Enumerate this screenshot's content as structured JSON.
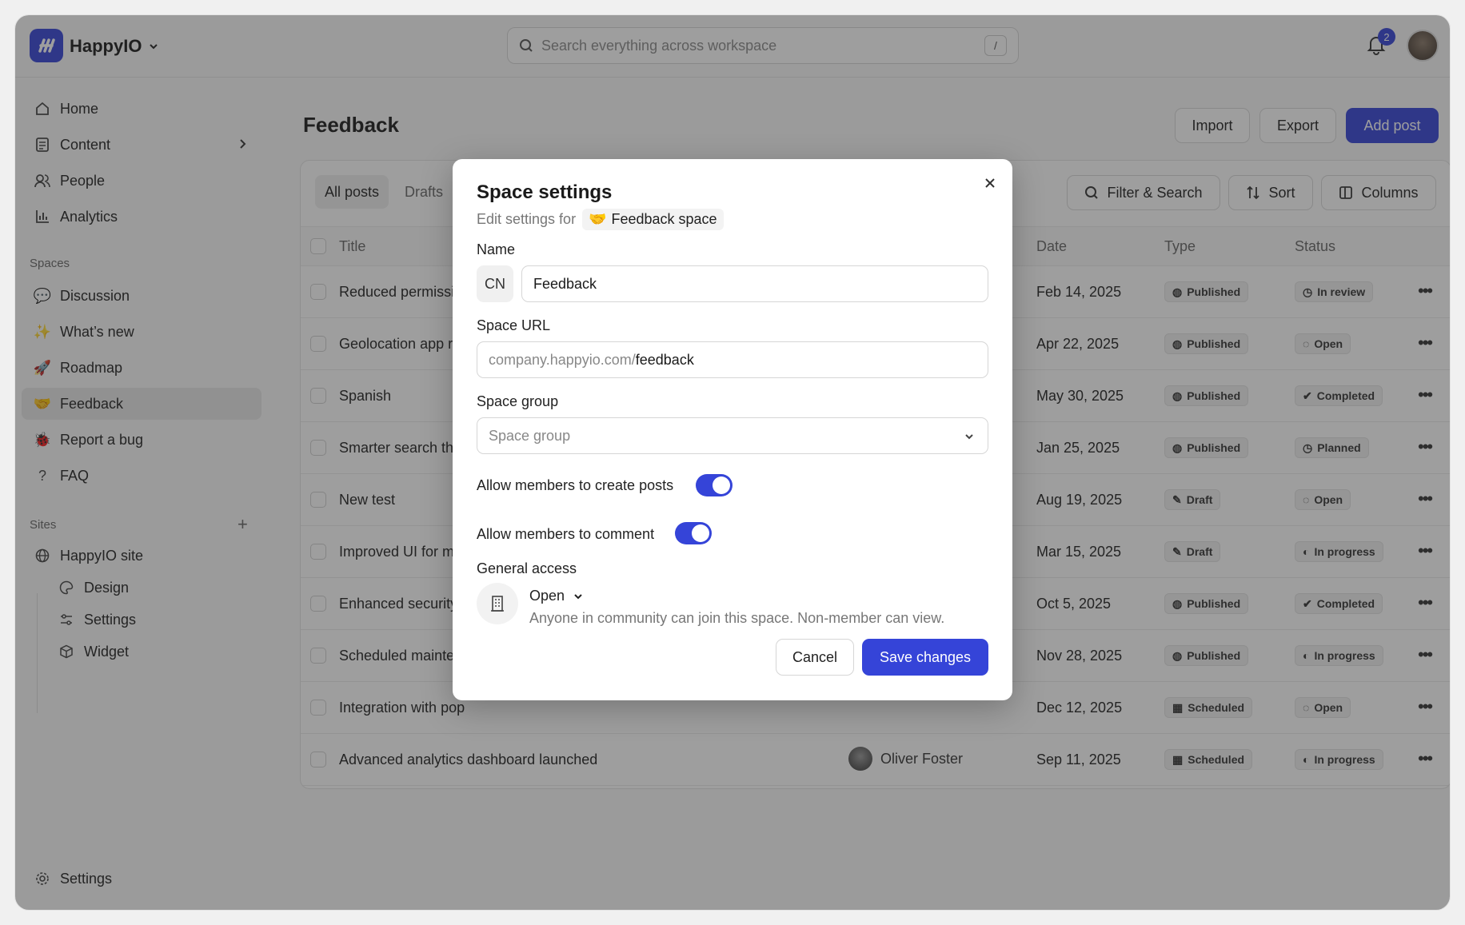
{
  "app": {
    "name": "HappyIO",
    "notifications": "2"
  },
  "search": {
    "placeholder": "Search everything across workspace",
    "shortcut": "/"
  },
  "sidebar": {
    "main": [
      {
        "label": "Home",
        "icon": "home-icon"
      },
      {
        "label": "Content",
        "icon": "document-icon"
      },
      {
        "label": "People",
        "icon": "people-icon"
      },
      {
        "label": "Analytics",
        "icon": "chart-icon"
      }
    ],
    "spaces_label": "Spaces",
    "spaces": [
      {
        "label": "Discussion",
        "icon": "speech-bubble-icon"
      },
      {
        "label": "What’s new",
        "icon": "sparkle-icon"
      },
      {
        "label": "Roadmap",
        "icon": "rocket-icon"
      },
      {
        "label": "Feedback",
        "icon": "handshake-icon"
      },
      {
        "label": "Report a bug",
        "icon": "bug-icon"
      },
      {
        "label": "FAQ",
        "icon": "question-icon"
      }
    ],
    "sites_label": "Sites",
    "sites": [
      {
        "label": "HappyIO site",
        "icon": "globe-icon"
      },
      {
        "label": "Design",
        "icon": "palette-icon"
      },
      {
        "label": "Settings",
        "icon": "sliders-icon"
      },
      {
        "label": "Widget",
        "icon": "cube-icon"
      }
    ],
    "footer": "Settings"
  },
  "page": {
    "title": "Feedback",
    "import": "Import",
    "export": "Export",
    "add_post": "Add post",
    "tabs": [
      "All posts",
      "Drafts"
    ],
    "filter": "Filter & Search",
    "sort": "Sort",
    "columns": "Columns"
  },
  "table": {
    "headers": {
      "title": "Title",
      "date": "Date",
      "type": "Type",
      "status": "Status"
    },
    "rows": [
      {
        "title": "Reduced permissio",
        "author": "",
        "date": "Feb 14, 2025",
        "type": "Published",
        "status": "In review"
      },
      {
        "title": "Geolocation app rer",
        "author": "",
        "date": "Apr 22, 2025",
        "type": "Published",
        "status": "Open"
      },
      {
        "title": "Spanish",
        "author": "",
        "date": "May 30, 2025",
        "type": "Published",
        "status": "Completed"
      },
      {
        "title": "Smarter search tha",
        "author": "",
        "date": "Jan 25, 2025",
        "type": "Published",
        "status": "Planned"
      },
      {
        "title": "New test",
        "author": "",
        "date": "Aug 19, 2025",
        "type": "Draft",
        "status": "Open"
      },
      {
        "title": "Improved UI for mo",
        "author": "",
        "date": "Mar 15, 2025",
        "type": "Draft",
        "status": "In progress"
      },
      {
        "title": "Enhanced security p",
        "author": "",
        "date": "Oct 5, 2025",
        "type": "Published",
        "status": "Completed"
      },
      {
        "title": "Scheduled mainten",
        "author": "",
        "date": "Nov 28, 2025",
        "type": "Published",
        "status": "In progress"
      },
      {
        "title": "Integration with pop",
        "author": "",
        "date": "Dec 12, 2025",
        "type": "Scheduled",
        "status": "Open"
      },
      {
        "title": "Advanced analytics dashboard launched",
        "author": "Oliver Foster",
        "date": "Sep 11, 2025",
        "type": "Scheduled",
        "status": "In progress"
      }
    ]
  },
  "modal": {
    "title": "Space settings",
    "subtitle": "Edit settings for",
    "space_name": "Feedback space",
    "name_label": "Name",
    "name_icon_text": "CN",
    "name_value": "Feedback",
    "url_label": "Space URL",
    "url_prefix": "company.happyio.com/",
    "url_slug": "feedback",
    "group_label": "Space group",
    "group_placeholder": "Space group",
    "toggle_posts": "Allow members to create posts",
    "toggle_comment": "Allow members to comment",
    "access_label": "General access",
    "access_value": "Open",
    "access_desc": "Anyone in community can join this space. Non-member can view.",
    "cancel": "Cancel",
    "save": "Save changes"
  },
  "colors": {
    "accent": "#3544d8"
  }
}
